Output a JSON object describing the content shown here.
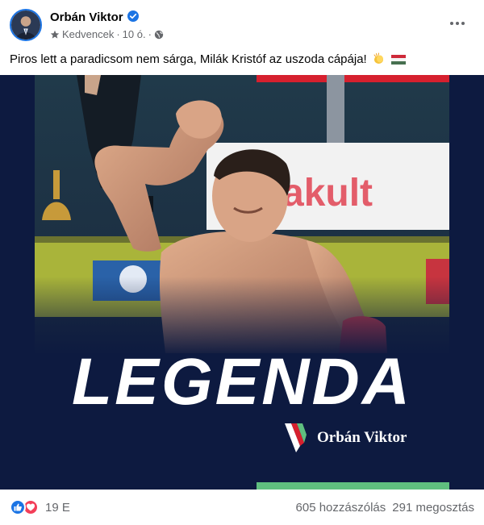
{
  "post": {
    "author": "Orbán Viktor",
    "verified": true,
    "audience": "Kedvencek",
    "time": "10 ó.",
    "separator": "·",
    "text": "Piros lett a paradicsom nem sárga, Milák Kristóf az uszoda cápája!",
    "text_emojis": [
      "clapping-hands-emoji",
      "hungarian-flag-emoji"
    ]
  },
  "image": {
    "headline": "LEGENDA",
    "brand_name": "Orbán Viktor",
    "banner_text": "akult",
    "colors": {
      "background": "#0d1a40",
      "red": "#d6202e",
      "green": "#5fbf7f",
      "white": "#ffffff"
    }
  },
  "footer": {
    "reaction_icons": [
      "like-icon",
      "love-icon"
    ],
    "reaction_count": "19 E",
    "comments": "605 hozzászólás",
    "shares": "291 megosztás"
  },
  "colors": {
    "accent": "#1b74e4",
    "secondary_text": "#65676b",
    "love": "#f33e58"
  }
}
